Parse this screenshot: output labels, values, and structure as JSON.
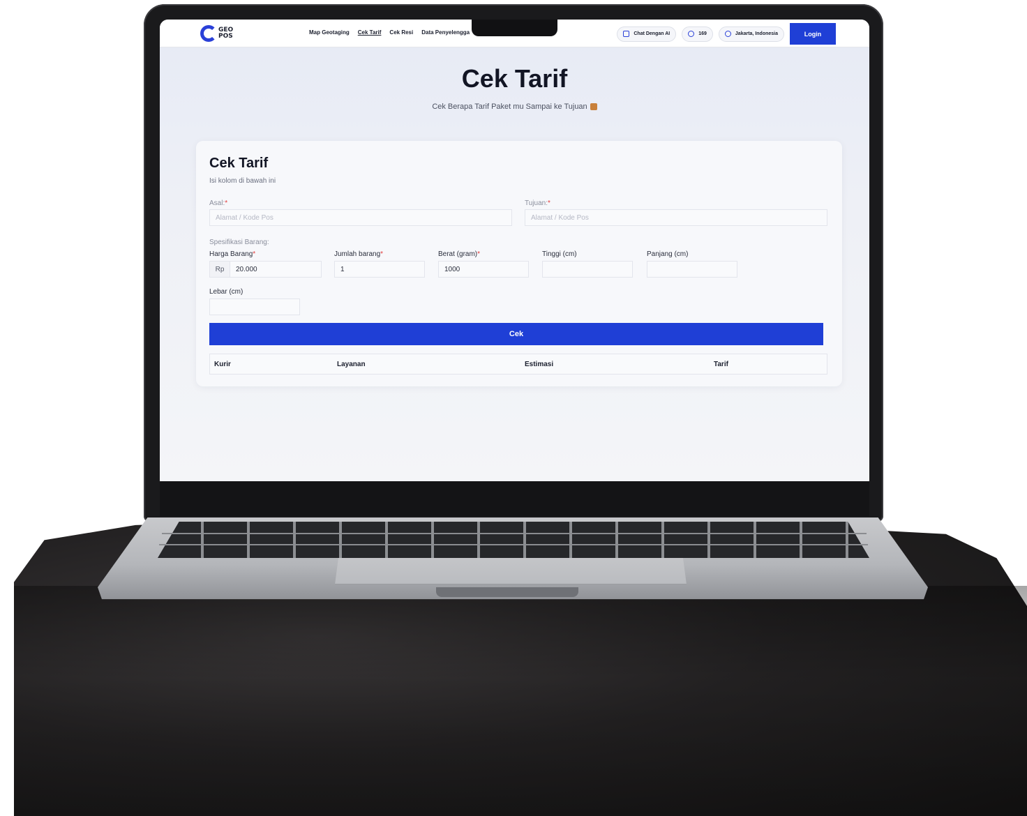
{
  "nav": {
    "logo_text": "GEO POS",
    "links": [
      "Map Geotaging",
      "Cek Tarif",
      "Cek Resi",
      "Data Penyelengga"
    ],
    "chat_label": "Chat Dengan AI",
    "phone_label": "169",
    "location_label": "Jakarta, Indonesia",
    "login_label": "Login",
    "accent_color": "#1f3fd6"
  },
  "hero": {
    "title": "Cek Tarif",
    "subtitle": "Cek Berapa Tarif Paket mu Sampai ke Tujuan"
  },
  "form": {
    "title": "Cek Tarif",
    "subtitle": "Isi kolom di bawah ini",
    "asal_label": "Asal:",
    "asal_placeholder": "Alamat / Kode Pos",
    "tujuan_label": "Tujuan:",
    "tujuan_placeholder": "Alamat / Kode Pos",
    "spec_label": "Spesifikasi Barang:",
    "harga_label": "Harga Barang",
    "harga_prefix": "Rp",
    "harga_value": "20.000",
    "jumlah_label": "Jumlah barang",
    "jumlah_value": "1",
    "berat_label": "Berat (gram)",
    "berat_value": "1000",
    "tinggi_label": "Tinggi (cm)",
    "tinggi_value": "",
    "panjang_label": "Panjang (cm)",
    "panjang_value": "",
    "lebar_label": "Lebar (cm)",
    "lebar_value": "",
    "submit_label": "Cek"
  },
  "results": {
    "columns": [
      "Kurir",
      "Layanan",
      "Estimasi",
      "Tarif"
    ]
  }
}
